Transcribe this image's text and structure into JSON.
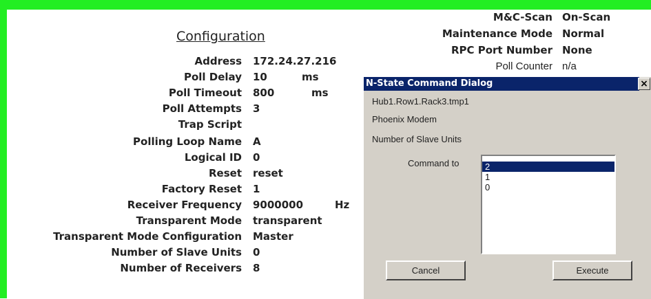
{
  "config": {
    "title": "Configuration",
    "rows": [
      {
        "label": "Address",
        "value": "172.24.27.216",
        "unit": ""
      },
      {
        "label": "Poll Delay",
        "value": "10",
        "unit": "ms"
      },
      {
        "label": "Poll Timeout",
        "value": "800",
        "unit": "ms"
      },
      {
        "label": "Poll Attempts",
        "value": "3",
        "unit": ""
      },
      {
        "label": "Trap Script",
        "value": "",
        "unit": ""
      },
      {
        "label": "Polling Loop Name",
        "value": "A",
        "unit": ""
      },
      {
        "label": "Logical ID",
        "value": "0",
        "unit": ""
      },
      {
        "label": "Reset",
        "value": "reset",
        "unit": ""
      },
      {
        "label": "Factory Reset",
        "value": "1",
        "unit": ""
      },
      {
        "label": "Receiver Frequency",
        "value": "9000000",
        "unit": "Hz"
      },
      {
        "label": "Transparent Mode",
        "value": "transparent",
        "unit": ""
      },
      {
        "label": "Transparent Mode Configuration",
        "value": "Master",
        "unit": ""
      },
      {
        "label": "Number of Slave Units",
        "value": "0",
        "unit": ""
      },
      {
        "label": "Number of Receivers",
        "value": "8",
        "unit": ""
      }
    ]
  },
  "status": {
    "rows": [
      {
        "label": "M&C-Scan",
        "value": "On-Scan"
      },
      {
        "label": "Maintenance Mode",
        "value": "Normal"
      },
      {
        "label": "RPC Port Number",
        "value": "None"
      },
      {
        "label": "Poll Counter",
        "value": "n/a"
      }
    ]
  },
  "dialog": {
    "title": "N-State Command Dialog",
    "close_glyph": "×",
    "path": "Hub1.Row1.Rack3.tmp1",
    "device": "Phoenix Modem",
    "parameter": "Number of Slave Units",
    "command_label": "Command to",
    "options": [
      "2",
      "1",
      "0"
    ],
    "selected": "2",
    "cancel_label": "Cancel",
    "execute_label": "Execute"
  },
  "colors": {
    "frame": "#22ee22",
    "titlebar": "#0a246a",
    "dialog_bg": "#d4d0c8"
  }
}
